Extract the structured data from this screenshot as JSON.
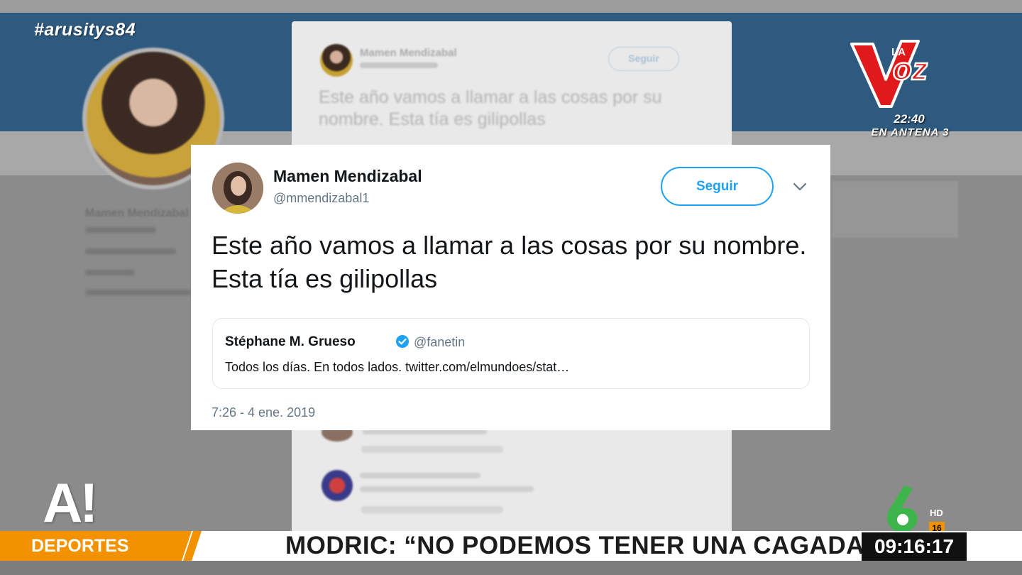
{
  "hashtag": "#arusitys84",
  "background_profile": {
    "name": "Mamen Mendizabal"
  },
  "rear_tweet": {
    "name": "Mamen Mendizabal",
    "follow_label": "Seguir",
    "text": "Este año vamos a llamar a las cosas por su nombre. Esta tía es gilipollas"
  },
  "tweet": {
    "author_name": "Mamen Mendizabal",
    "author_handle": "@mmendizabal1",
    "follow_label": "Seguir",
    "text": "Este año vamos a llamar a las cosas por su nombre. Esta tía es gilipollas",
    "quote": {
      "author_name": "Stéphane M. Grueso",
      "author_handle": "@fanetin",
      "text": "Todos los días. En todos lados. twitter.com/elmundoes/stat…"
    },
    "timestamp": "7:26 - 4 ene. 2019",
    "icons": [
      "chevron-down-icon",
      "verified-icon"
    ]
  },
  "promo": {
    "show_logo_text": "La Voz",
    "time": "22:40",
    "channel": "EN ANTENA 3"
  },
  "channel_logo_text": "A!",
  "broadcaster": {
    "hd_label": "HD",
    "age_rating": "16"
  },
  "ticker": {
    "section": "DEPORTES",
    "headline": "MODRIC: “NO PODEMOS TENER UNA CAGADA",
    "clock": "09:16:17"
  },
  "colors": {
    "twitter_blue": "#1da1f2",
    "antena3_orange": "#f39200",
    "banner_blue": "#2e5a80",
    "lasexta_green": "#3db54a"
  }
}
